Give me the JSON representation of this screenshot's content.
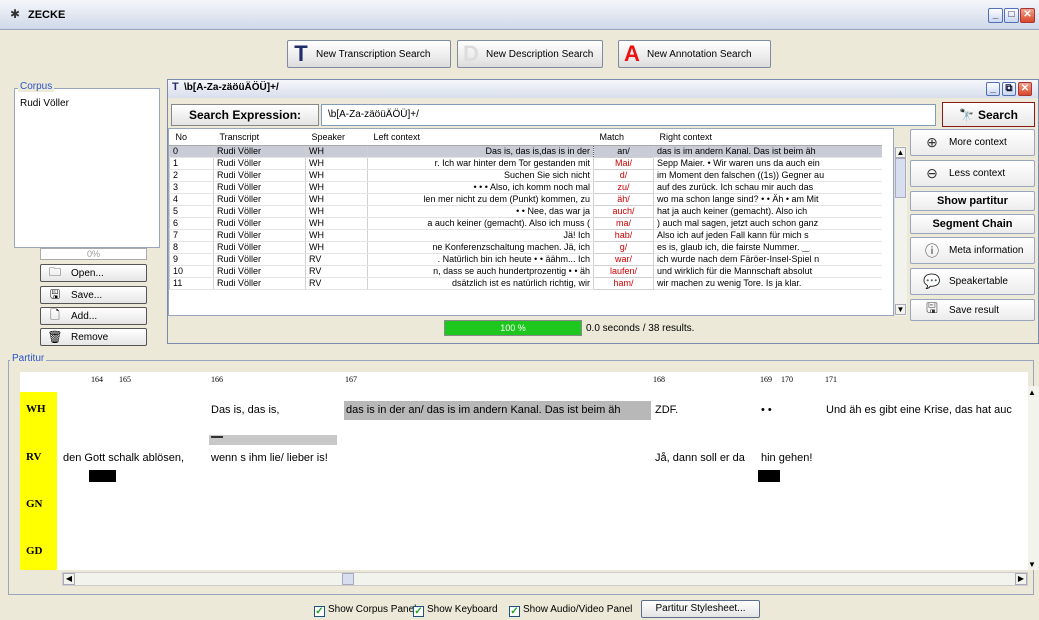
{
  "app": {
    "title": "ZECKE"
  },
  "toolbar": {
    "transcription_search": "New Transcription Search",
    "description_search": "New Description Search",
    "annotation_search": "New Annotation Search",
    "transcription_icon": "T",
    "annotation_icon": "A"
  },
  "corpus": {
    "label": "Corpus",
    "items": [
      "Rudi Völler"
    ],
    "progress": "0%",
    "progress_value": 0,
    "buttons": {
      "open": "Open...",
      "save": "Save...",
      "add": "Add...",
      "remove": "Remove"
    }
  },
  "search": {
    "window_title": "\\b[A-Za-zäöüÄÖÜ]+/",
    "expression_label": "Search Expression:",
    "expression_value": "\\b[A-Za-zäöüÄÖÜ]+/",
    "search_button": "Search",
    "columns": [
      "No",
      "Transcript",
      "Speaker",
      "Left context",
      "Match",
      "Right context"
    ],
    "rows": [
      {
        "no": "0",
        "transcript": "Rudi Völler",
        "speaker": "WH",
        "left": "Das is, das is,das is in der",
        "match": "an/",
        "right": "das is im andern Kanal. Das ist beim äh"
      },
      {
        "no": "1",
        "transcript": "Rudi Völler",
        "speaker": "WH",
        "left": "r. Ich war hinter dem Tor gestanden mit",
        "match": "Mai/",
        "right": "Sepp Maier. • Wir waren uns da auch ein"
      },
      {
        "no": "2",
        "transcript": "Rudi Völler",
        "speaker": "WH",
        "left": "Suchen Sie sich nicht",
        "match": "d/",
        "right": "im Moment den falschen ((1s)) Gegner au"
      },
      {
        "no": "3",
        "transcript": "Rudi Völler",
        "speaker": "WH",
        "left": "• • • Also, ich komm noch mal",
        "match": "zu/",
        "right": "auf des zurück. Ich schau mir auch das"
      },
      {
        "no": "4",
        "transcript": "Rudi Völler",
        "speaker": "WH",
        "left": "len mer nicht zu dem (Punkt) kommen, zu",
        "match": "äh/",
        "right": "wo ma schon lange sind? • • Äh • am Mit"
      },
      {
        "no": "5",
        "transcript": "Rudi Völler",
        "speaker": "WH",
        "left": "• • Nee, das war ja",
        "match": "auch/",
        "right": "hat ja auch keiner (gemacht). Also ich"
      },
      {
        "no": "6",
        "transcript": "Rudi Völler",
        "speaker": "WH",
        "left": "a auch keiner (gemacht). Also ich muss (",
        "match": "ma/",
        "right": ") auch mal sagen, jetzt auch schon ganz"
      },
      {
        "no": "7",
        "transcript": "Rudi Völler",
        "speaker": "WH",
        "left": "Jä! Ich",
        "match": "hab/",
        "right": "Also ich auf jeden Fall kann für mich s"
      },
      {
        "no": "8",
        "transcript": "Rudi Völler",
        "speaker": "WH",
        "left": "ne Konferenzschaltung machen. Jä, ich",
        "match": "g/",
        "right": "es is, glaub ich, die fairste Nummer. ‿"
      },
      {
        "no": "9",
        "transcript": "Rudi Völler",
        "speaker": "RV",
        "left": ". Natürlich bin ich heute • • äähm... Ich",
        "match": "war/",
        "right": "ich wurde nach dem Färöer-Insel-Spiel n"
      },
      {
        "no": "10",
        "transcript": "Rudi Völler",
        "speaker": "RV",
        "left": "n, dass se auch hundertprozentig • • äh",
        "match": "laufen/",
        "right": "und wirklich für die Mannschaft absolut"
      },
      {
        "no": "11",
        "transcript": "Rudi Völler",
        "speaker": "RV",
        "left": "dsätzlich ist es natürlich richtig, wir",
        "match": "ham/",
        "right": "wir machen zu wenig Tore. Is ja klar."
      }
    ],
    "progress": "100 %",
    "progress_value": 100,
    "status": "0.0 seconds / 38 results."
  },
  "side_buttons": {
    "more_context": "More context",
    "less_context": "Less context",
    "show_partitur": "Show partitur",
    "segment_chain": "Segment Chain",
    "meta_information": "Meta information",
    "speakertable": "Speakertable",
    "save_result": "Save result"
  },
  "partitur": {
    "label": "Partitur",
    "ticks": [
      "164",
      "165",
      "166",
      "167",
      "168",
      "169",
      "170",
      "171"
    ],
    "speakers": [
      "WH",
      "RV",
      "GN",
      "GD"
    ],
    "wh": {
      "seg1": "Das is, das is,",
      "seg2": "das is in der an/ das is im andern Kanal. Das ist beim äh",
      "seg3": "ZDF.",
      "seg4": "• •",
      "seg5": "Und äh es gibt eine Krise, das hat auc"
    },
    "rv": {
      "seg1": "den  Gott schalk ablösen,",
      "seg2": "wenn s ihm lie/ lieber is!",
      "seg3": "Jå, dann soll er da",
      "seg4": "hin gehen!"
    }
  },
  "bottom": {
    "show_corpus_panel": "Show Corpus Panel",
    "show_keyboard": "Show Keyboard",
    "show_av_panel": "Show Audio/Video Panel",
    "stylesheet_button": "Partitur Stylesheet...",
    "show_corpus_checked": true,
    "show_keyboard_checked": true,
    "show_av_checked": true
  },
  "colors": {
    "speaker_bg": "#ffff00",
    "progress": "#1ec71e",
    "match": "#cc0000",
    "highlight": "#b8b8b8"
  }
}
